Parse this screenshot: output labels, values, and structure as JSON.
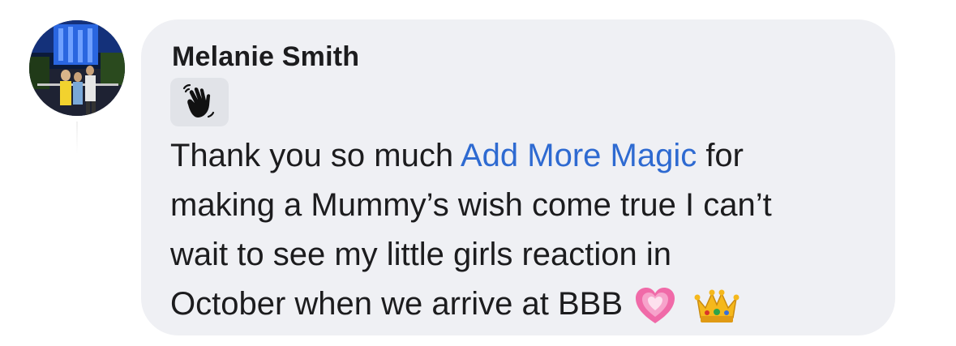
{
  "comment": {
    "author": "Melanie Smith",
    "badge_icon": "wave-hand-icon",
    "message": {
      "line1_before": "Thank you so much ",
      "mention": "Add More Magic",
      "line1_after": " for",
      "line2": "making a Mummy’s wish come true I can’t",
      "line3": "wait to see my little girls reaction in",
      "line4": "October when we arrive at BBB"
    },
    "emojis": [
      "growing-heart-emoji",
      "crown-emoji"
    ]
  },
  "colors": {
    "bubble": "#eff0f4",
    "text": "#1c1c1e",
    "mention": "#2e6ad1"
  }
}
